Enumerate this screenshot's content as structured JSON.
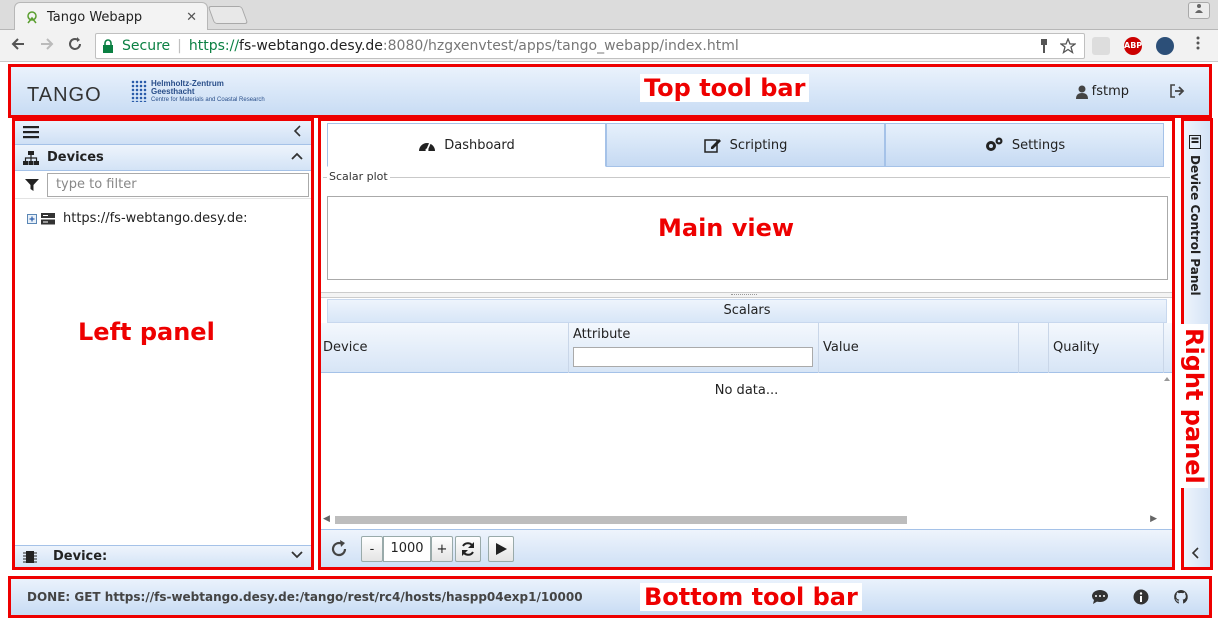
{
  "browser": {
    "tab_title": "Tango Webapp",
    "tab_close": "✕",
    "secure_label": "Secure",
    "url_scheme": "https://",
    "url_host": "fs-webtango.desy.de",
    "url_rest": ":8080/hzgxenvtest/apps/tango_webapp/index.html",
    "ext_abp": "ABP"
  },
  "topbar": {
    "logo_text": "TANGO",
    "hzg_line1": "Helmholtz-Zentrum",
    "hzg_line2": "Geesthacht",
    "hzg_line3": "Centre for Materials and Coastal Research",
    "username": "fstmp"
  },
  "left_panel": {
    "devices_label": "Devices",
    "filter_placeholder": "type to filter",
    "tree_root": "https://fs-webtango.desy.de:",
    "device_footer": "Device:"
  },
  "main": {
    "tabs": [
      {
        "label": "Dashboard",
        "active": true
      },
      {
        "label": "Scripting",
        "active": false
      },
      {
        "label": "Settings",
        "active": false
      }
    ],
    "scalar_plot_label": "Scalar plot",
    "scalars_title": "Scalars",
    "columns": [
      "Device",
      "Attribute",
      "Value",
      "",
      "Quality"
    ],
    "no_data": "No data...",
    "refresh_rate": "1000",
    "minus": "-",
    "plus": "+"
  },
  "right_panel": {
    "title": "Device Control Panel"
  },
  "bottom_bar": {
    "status": "DONE: GET https://fs-webtango.desy.de:/tango/rest/rc4/hosts/haspp04exp1/10000"
  },
  "annotations": {
    "top": "Top tool bar",
    "left": "Left panel",
    "main": "Main view",
    "right": "Right panel",
    "bottom": "Bottom tool bar"
  },
  "colors": {
    "annotation": "#e00000",
    "panel_border": "#a5c2e8",
    "secure_green": "#0b8043"
  }
}
